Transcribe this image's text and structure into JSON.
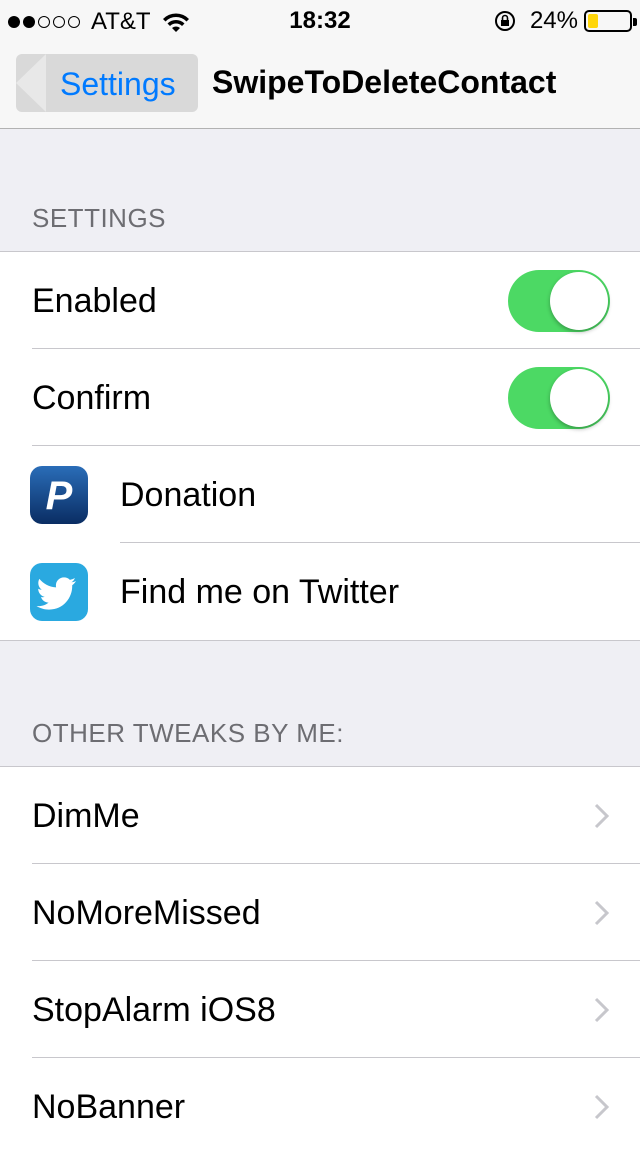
{
  "status_bar": {
    "signal_full": 2,
    "signal_total": 5,
    "carrier": "AT&T",
    "time": "18:32",
    "battery_percent": "24%",
    "battery_level": 0.24
  },
  "nav": {
    "back_label": "Settings",
    "title": "SwipeToDeleteContact"
  },
  "sections": {
    "settings_header": "SETTINGS",
    "other_header": "OTHER TWEAKS BY ME:"
  },
  "settings": {
    "enabled_label": "Enabled",
    "enabled_on": true,
    "confirm_label": "Confirm",
    "confirm_on": true,
    "donation_label": "Donation",
    "twitter_label": "Find me on Twitter"
  },
  "other_tweaks": [
    {
      "label": "DimMe"
    },
    {
      "label": "NoMoreMissed"
    },
    {
      "label": "StopAlarm iOS8"
    },
    {
      "label": "NoBanner"
    }
  ],
  "colors": {
    "accent": "#007aff",
    "toggle_on": "#4cd964",
    "battery": "#ffd60a",
    "background": "#efeff4"
  },
  "icons": {
    "donation": "paypal-icon",
    "twitter": "twitter-icon",
    "disclosure": "chevron-right-icon"
  }
}
